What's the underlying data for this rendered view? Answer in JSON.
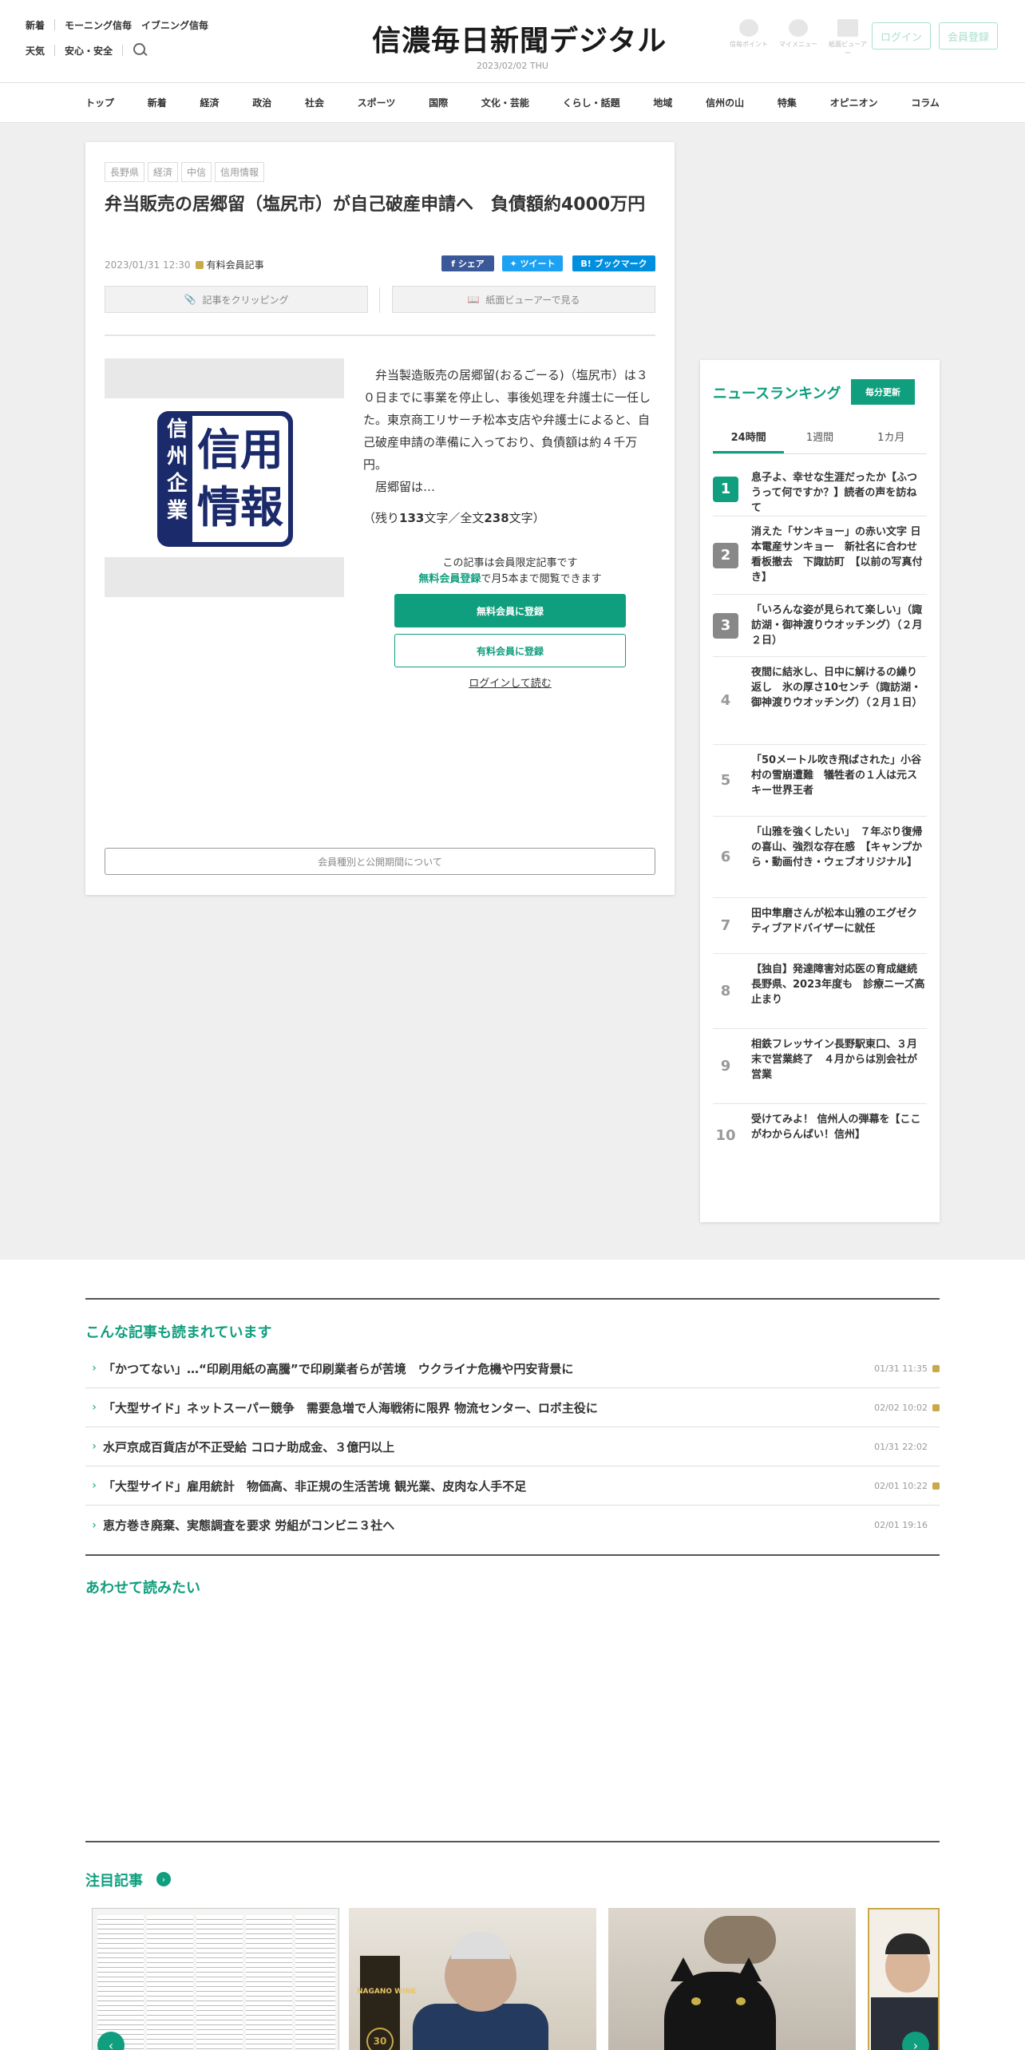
{
  "header": {
    "links_row1": [
      "新着",
      "モーニング信毎",
      "イブニング信毎"
    ],
    "links_row2": [
      "天気",
      "安心・安全"
    ],
    "logo": "信濃毎日新聞デジタル",
    "date": "2023/02/02",
    "weekday": "THU",
    "icons": [
      "信毎ポイント",
      "マイメニュー",
      "紙面ビューアー"
    ],
    "login": "ログイン",
    "register": "会員登録"
  },
  "nav": [
    "トップ",
    "新着",
    "経済",
    "政治",
    "社会",
    "スポーツ",
    "国際",
    "文化・芸能",
    "くらし・話題",
    "地域",
    "信州の山",
    "特集",
    "オピニオン",
    "コラム"
  ],
  "article": {
    "tags": [
      "長野県",
      "経済",
      "中信",
      "信用情報"
    ],
    "title": "弁当販売の居郷留（塩尻市）が自己破産申請へ　負債額約4000万円",
    "datetime": "2023/01/31 12:30",
    "member_label": "有料会員記事",
    "share": {
      "facebook": "シェア",
      "twitter": "ツイート",
      "hatena": "ブックマーク"
    },
    "clip": "記事をクリッピング",
    "viewer": "紙面ビューアーで見る",
    "image_text_left": "信州企業",
    "image_text_right": "信用情報",
    "body": [
      "弁当製造販売の居郷留(おるごーる)（塩尻市）は３０日までに事業を停止し、事後処理を弁護士に一任した。東京商工リサーチ松本支店や弁護士によると、自己破産申請の準備に入っており、負債額は約４千万円。",
      "居郷留は…"
    ],
    "remaining_prefix": "（残り",
    "remaining_count": "133",
    "remaining_mid": "文字／全文",
    "total_count": "238",
    "remaining_suffix": "文字）",
    "limited_line1": "この記事は会員限定記事です",
    "limited_free": "無料会員登録",
    "limited_rest": "で月5本まで閲覧できます",
    "cta_free": "無料会員に登録",
    "cta_paid": "有料会員に登録",
    "login_read": "ログインして読む",
    "about": "会員種別と公開期間について"
  },
  "ranking": {
    "title": "ニュースランキング",
    "badge": "毎分更新",
    "tabs": [
      "24時間",
      "1週間",
      "1カ月"
    ],
    "items": [
      {
        "rank": "1",
        "text": "息子よ、幸せな生涯だったか【ふつうって何ですか？】読者の声を訪ねて"
      },
      {
        "rank": "2",
        "text": "消えた「サンキョー」の赤い文字 日本電産サンキョー　新社名に合わせ看板撤去　下諏訪町　【以前の写真付き】"
      },
      {
        "rank": "3",
        "text": "「いろんな姿が見られて楽しい」（諏訪湖・御神渡りウオッチング）（２月２日）"
      },
      {
        "rank": "4",
        "text": "夜間に結氷し、日中に解けるの繰り返し　氷の厚さ10センチ（諏訪湖・御神渡りウオッチング）（２月１日）"
      },
      {
        "rank": "5",
        "text": "「50メートル吹き飛ばされた」小谷村の雪崩遭難　犠牲者の１人は元スキー世界王者"
      },
      {
        "rank": "6",
        "text": "「山雅を強くしたい」　７年ぶり復帰の喜山、強烈な存在感　【キャンプから・動画付き・ウェブオリジナル】"
      },
      {
        "rank": "7",
        "text": "田中隼磨さんが松本山雅のエグゼクティブアドバイザーに就任"
      },
      {
        "rank": "8",
        "text": "【独自】発達障害対応医の育成継続　長野県、2023年度も　診療ニーズ高止まり"
      },
      {
        "rank": "9",
        "text": "相鉄フレッサイン長野駅東口、３月末で営業終了　４月からは別会社が営業"
      },
      {
        "rank": "10",
        "text": "受けてみよ！ 信州人の弾幕を【ここがわからんばい！信州】"
      }
    ]
  },
  "also_read": {
    "title": "こんな記事も読まれています",
    "items": [
      {
        "text": "「かつてない」…“印刷用紙の高騰”で印刷業者らが苦境　ウクライナ危機や円安背景に",
        "date": "01/31 11:35",
        "locked": true
      },
      {
        "text": "「大型サイド」ネットスーパー競争　需要急増で人海戦術に限界 物流センター、ロボ主役に",
        "date": "02/02 10:02",
        "locked": true
      },
      {
        "text": "水戸京成百貨店が不正受給 コロナ助成金、３億円以上",
        "date": "01/31 22:02",
        "locked": false
      },
      {
        "text": "「大型サイド」雇用統計　物価高、非正規の生活苦境 観光業、皮肉な人手不足",
        "date": "02/01 10:22",
        "locked": true
      },
      {
        "text": "恵方巻き廃棄、実態調査を要求 労組がコンビニ３社へ",
        "date": "02/01 19:16",
        "locked": false
      }
    ]
  },
  "together": {
    "title": "あわせて読みたい"
  },
  "featured": {
    "title": "注目記事",
    "wine_label": "NAGANO WINE",
    "wine_anniv": "30"
  },
  "colors": {
    "accent": "#0f9e7e",
    "lock": "#c9a94a",
    "facebook": "#3b5998",
    "twitter": "#1da1f2",
    "hatena": "#008fde"
  }
}
